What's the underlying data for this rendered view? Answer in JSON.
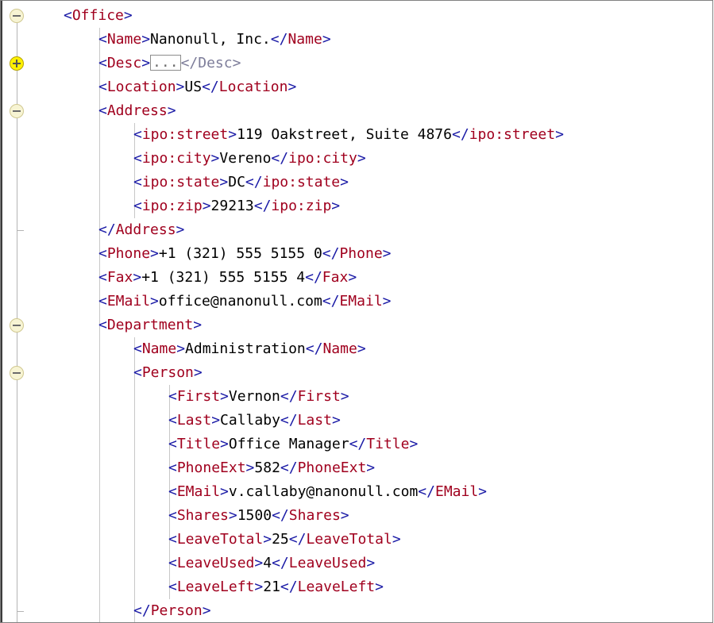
{
  "lines": [
    {
      "indent": 0,
      "kind": "open",
      "tag": "Office"
    },
    {
      "indent": 1,
      "kind": "element",
      "tag": "Name",
      "text": "Nanonull, Inc."
    },
    {
      "indent": 1,
      "kind": "collapsed",
      "tag": "Desc",
      "text": "..."
    },
    {
      "indent": 1,
      "kind": "element",
      "tag": "Location",
      "text": "US"
    },
    {
      "indent": 1,
      "kind": "open",
      "tag": "Address"
    },
    {
      "indent": 2,
      "kind": "element",
      "tag": "ipo:street",
      "text": "119 Oakstreet, Suite 4876"
    },
    {
      "indent": 2,
      "kind": "element",
      "tag": "ipo:city",
      "text": "Vereno"
    },
    {
      "indent": 2,
      "kind": "element",
      "tag": "ipo:state",
      "text": "DC"
    },
    {
      "indent": 2,
      "kind": "element",
      "tag": "ipo:zip",
      "text": "29213"
    },
    {
      "indent": 1,
      "kind": "close",
      "tag": "Address"
    },
    {
      "indent": 1,
      "kind": "element",
      "tag": "Phone",
      "text": "+1 (321) 555 5155 0"
    },
    {
      "indent": 1,
      "kind": "element",
      "tag": "Fax",
      "text": "+1 (321) 555 5155 4"
    },
    {
      "indent": 1,
      "kind": "element",
      "tag": "EMail",
      "text": "office@nanonull.com"
    },
    {
      "indent": 1,
      "kind": "open",
      "tag": "Department"
    },
    {
      "indent": 2,
      "kind": "element",
      "tag": "Name",
      "text": "Administration"
    },
    {
      "indent": 2,
      "kind": "open",
      "tag": "Person"
    },
    {
      "indent": 3,
      "kind": "element",
      "tag": "First",
      "text": "Vernon"
    },
    {
      "indent": 3,
      "kind": "element",
      "tag": "Last",
      "text": "Callaby"
    },
    {
      "indent": 3,
      "kind": "element",
      "tag": "Title",
      "text": "Office Manager"
    },
    {
      "indent": 3,
      "kind": "element",
      "tag": "PhoneExt",
      "text": "582"
    },
    {
      "indent": 3,
      "kind": "element",
      "tag": "EMail",
      "text": "v.callaby@nanonull.com"
    },
    {
      "indent": 3,
      "kind": "element",
      "tag": "Shares",
      "text": "1500"
    },
    {
      "indent": 3,
      "kind": "element",
      "tag": "LeaveTotal",
      "text": "25"
    },
    {
      "indent": 3,
      "kind": "element",
      "tag": "LeaveUsed",
      "text": "4"
    },
    {
      "indent": 3,
      "kind": "element",
      "tag": "LeaveLeft",
      "text": "21"
    },
    {
      "indent": 2,
      "kind": "close",
      "tag": "Person"
    }
  ],
  "folds": [
    {
      "state": "expanded",
      "icon": "fold-collapse-icon"
    },
    {
      "state": "collapsed",
      "icon": "fold-expand-icon"
    }
  ]
}
